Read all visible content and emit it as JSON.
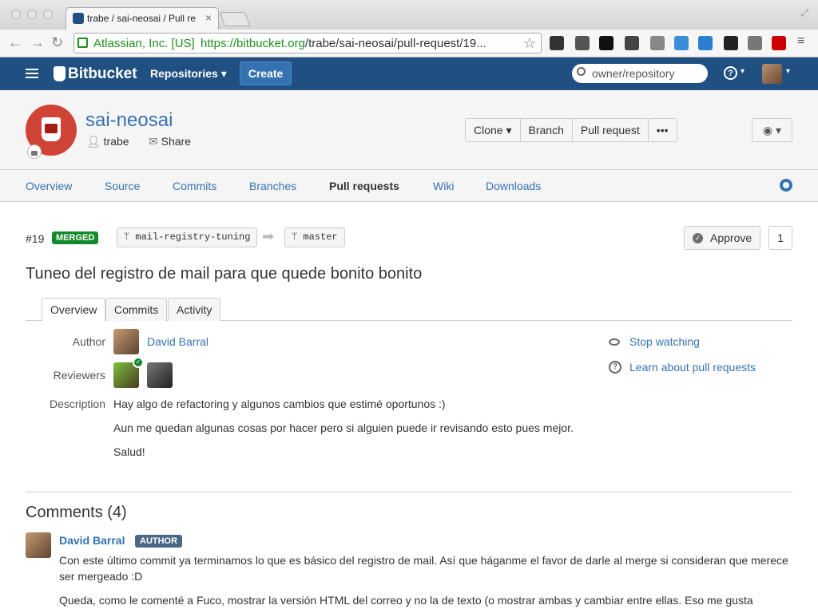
{
  "browser": {
    "tab_title": "trabe / sai-neosai / Pull re",
    "ev_cert": "Atlassian, Inc. [US]",
    "url_host": "https://bitbucket.org",
    "url_path": "/trabe/sai-neosai/pull-request/19...",
    "tab_close": "×",
    "star": "☆"
  },
  "header": {
    "logo_text": "Bitbucket",
    "repositories_label": "Repositories ▾",
    "create_label": "Create",
    "search_placeholder": "owner/repository",
    "help_symbol": "?",
    "caret": "▾"
  },
  "repo": {
    "name": "sai-neosai",
    "owner": "trabe",
    "share_label": "Share",
    "actions": [
      "Clone ▾",
      "Branch",
      "Pull request",
      "•••"
    ],
    "watch_label": "◉ ▾"
  },
  "nav": {
    "items": [
      "Overview",
      "Source",
      "Commits",
      "Branches",
      "Pull requests",
      "Wiki",
      "Downloads"
    ],
    "active": "Pull requests"
  },
  "pr": {
    "id": "#19",
    "status": "MERGED",
    "source_branch": "ᛘ mail-registry-tuning",
    "target_branch": "ᛘ master",
    "arrow": "➡",
    "approve_label": "Approve",
    "approve_check": "✓",
    "approve_count": "1",
    "title": "Tuneo del registro de mail para que quede bonito bonito",
    "tabs": [
      "Overview",
      "Commits",
      "Activity"
    ],
    "author_label": "Author",
    "author_name": "David Barral",
    "reviewers_label": "Reviewers",
    "description_label": "Description",
    "description": [
      "Hay algo de refactoring y algunos cambios que estimé oportunos :)",
      "Aun me quedan algunas cosas por hacer pero si alguien puede ir revisando esto pues mejor.",
      "Salud!"
    ],
    "stop_watching": "Stop watching",
    "learn_more": "Learn about pull requests"
  },
  "comments": {
    "title": "Comments (4)",
    "first_author": "David Barral",
    "author_badge": "AUTHOR",
    "first_text": "Con este último commit ya terminamos lo que es básico del registro de mail. Así que háganme el favor de darle al merge si consideran que merece ser mergeado :D",
    "second_text": "Queda, como le comenté a Fuco, mostrar la versión HTML del correo y no la de texto (o mostrar ambas y cambiar entre ellas. Eso me gusta"
  }
}
